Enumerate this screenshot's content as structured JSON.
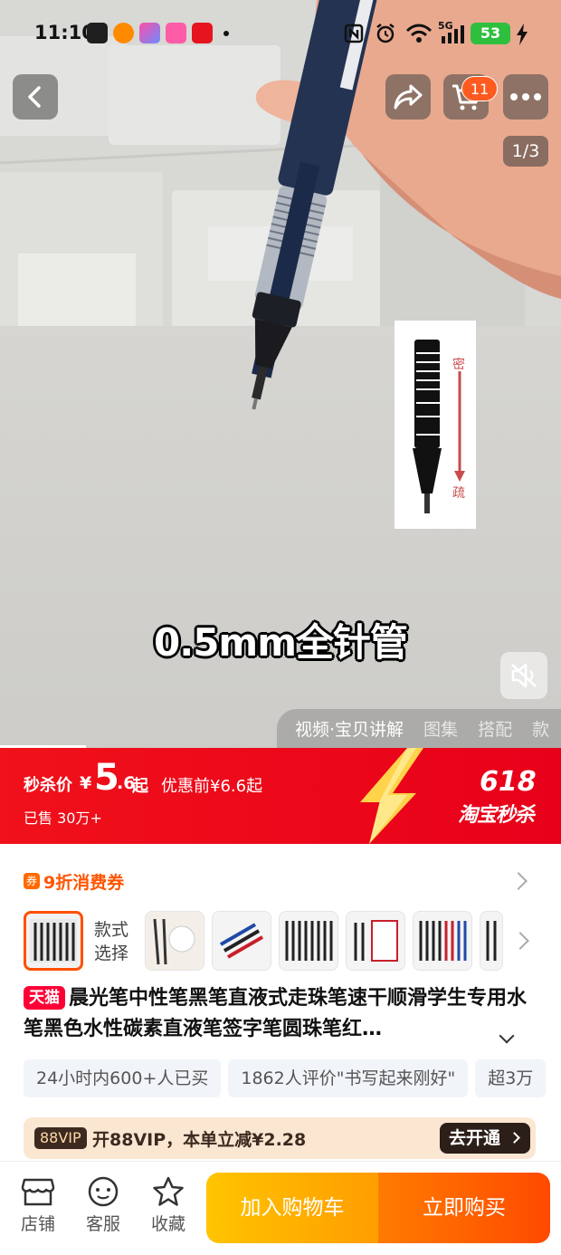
{
  "status_bar": {
    "time": "11:10",
    "network": "5G",
    "battery": "53"
  },
  "hero": {
    "image_counter": "1/3",
    "cart_count": "11",
    "caption": "0.5mm全针管",
    "icons": {
      "back": "back-arrow-icon",
      "share": "share-icon",
      "cart": "cart-icon",
      "more": "more-icon",
      "mute": "mute-icon"
    },
    "media_tabs": [
      "视频·宝贝讲解",
      "图集",
      "搭配",
      "款"
    ],
    "active_media_tab": 0
  },
  "promo": {
    "label": "秒杀价",
    "currency": "¥",
    "price_int": "5",
    "price_dec": ".6",
    "price_suffix": "起",
    "before_price": "优惠前¥6.6起",
    "sold": "已售 30万+",
    "event_number": "618",
    "event_brand": "淘宝秒杀"
  },
  "coupon": {
    "icon": "coupon-icon",
    "text": "9折消费券"
  },
  "variants": {
    "label_line1": "款式",
    "label_line2": "选择",
    "thumb_count": 8,
    "selected_index": 0
  },
  "product": {
    "store_badge": "天猫",
    "title": "晨光笔中性笔黑笔直液式走珠笔速干顺滑学生专用水笔黑色水性碳素直液笔签字笔圆珠笔红…"
  },
  "tags": [
    "24小时内600+人已买",
    "1862人评价\"书写起来刚好\"",
    "超3万"
  ],
  "vip": {
    "badge": "88VIP",
    "text": "开88VIP，本单立减¥2.28",
    "button": "去开通"
  },
  "bottom_bar": {
    "store": "店铺",
    "service": "客服",
    "favorite": "收藏",
    "add_to_cart": "加入购物车",
    "buy_now": "立即购买"
  },
  "colors": {
    "promo_red": "#f0111a",
    "accent_orange": "#ff5000",
    "cart_yellow": "#ffb000",
    "buy_orange": "#ff5a00"
  }
}
